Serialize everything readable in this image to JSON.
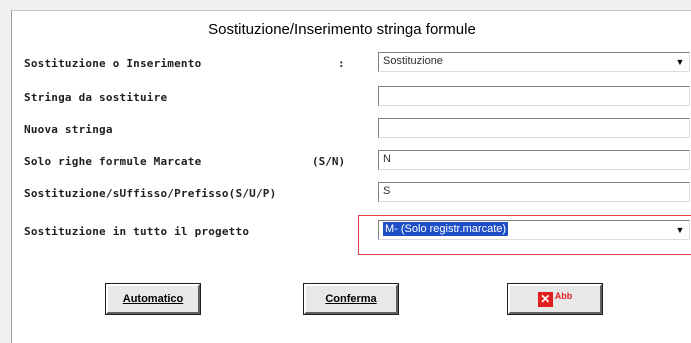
{
  "dialog": {
    "title": "Sostituzione/Inserimento stringa formule"
  },
  "rows": [
    {
      "label": "Sostituzione o Inserimento",
      "aside": ":",
      "value": "Sostituzione",
      "type": "combo"
    },
    {
      "label": "Stringa da sostituire",
      "aside": "",
      "value": "",
      "type": "text"
    },
    {
      "label": "Nuova stringa",
      "aside": "",
      "value": "",
      "type": "text"
    },
    {
      "label": "Solo righe formule Marcate",
      "aside": "(S/N)",
      "value": "N",
      "type": "text"
    },
    {
      "label": "Sostituzione/sUffisso/Prefisso(S/U/P)",
      "aside": "",
      "value": "S",
      "type": "text"
    },
    {
      "label": "Sostituzione in tutto il progetto",
      "aside": "",
      "value": "M- (Solo registr.marcate)",
      "type": "combo"
    }
  ],
  "buttons": {
    "automatico": "Automatico",
    "conferma": "Conferma",
    "abb": "Abb"
  },
  "icons": {
    "dropdown": "chevron-down-icon",
    "cancel": "close-icon"
  },
  "colors": {
    "selection": "#1f4fc8",
    "highlight_frame": "#e04040",
    "cancel_red": "#e02020"
  }
}
